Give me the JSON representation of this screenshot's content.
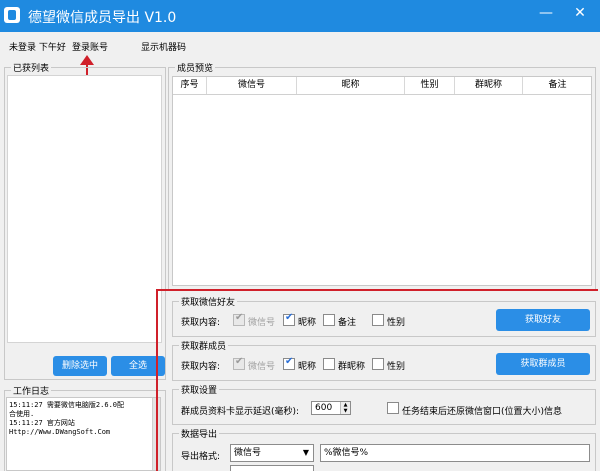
{
  "window": {
    "title": "德望微信成员导出 V1.0",
    "minimize": "—",
    "close": "✕"
  },
  "menubar": {
    "status": "未登录 下午好",
    "login": "登录账号",
    "show_code": "显示机器码"
  },
  "left_panel": {
    "group_label": "已获列表",
    "delete_button": "删除选中",
    "select_all_button": "全选"
  },
  "log": {
    "group_label": "工作日志",
    "lines": [
      "15:11:27  需要微信电脑版2.6.0配",
      "合使用.",
      "15:11:27  官方网站",
      "Http://Www.DWangSoft.Com"
    ]
  },
  "preview": {
    "group_label": "成员预览",
    "columns": [
      "序号",
      "微信号",
      "昵称",
      "性别",
      "群昵称",
      "备注"
    ]
  },
  "friends": {
    "group_label": "获取微信好友",
    "content_label": "获取内容:",
    "options": [
      {
        "label": "微信号",
        "checked": true,
        "disabled": true
      },
      {
        "label": "昵称",
        "checked": true,
        "disabled": false
      },
      {
        "label": "备注",
        "checked": false,
        "disabled": false
      },
      {
        "label": "性别",
        "checked": false,
        "disabled": false
      }
    ],
    "button": "获取好友"
  },
  "members": {
    "group_label": "获取群成员",
    "content_label": "获取内容:",
    "options": [
      {
        "label": "微信号",
        "checked": true,
        "disabled": true
      },
      {
        "label": "昵称",
        "checked": true,
        "disabled": false
      },
      {
        "label": "群昵称",
        "checked": false,
        "disabled": false
      },
      {
        "label": "性别",
        "checked": false,
        "disabled": false
      }
    ],
    "button": "获取群成员"
  },
  "settings": {
    "group_label": "获取设置",
    "delay_label": "群成员资料卡显示延迟(毫秒):",
    "delay_value": "600",
    "restore_label": "任务结束后还原微信窗口(位置大小)信息",
    "restore_checked": false
  },
  "export": {
    "group_label": "数据导出",
    "format_label": "导出格式:",
    "format_select": "微信号",
    "format_value": "%微信号%"
  }
}
